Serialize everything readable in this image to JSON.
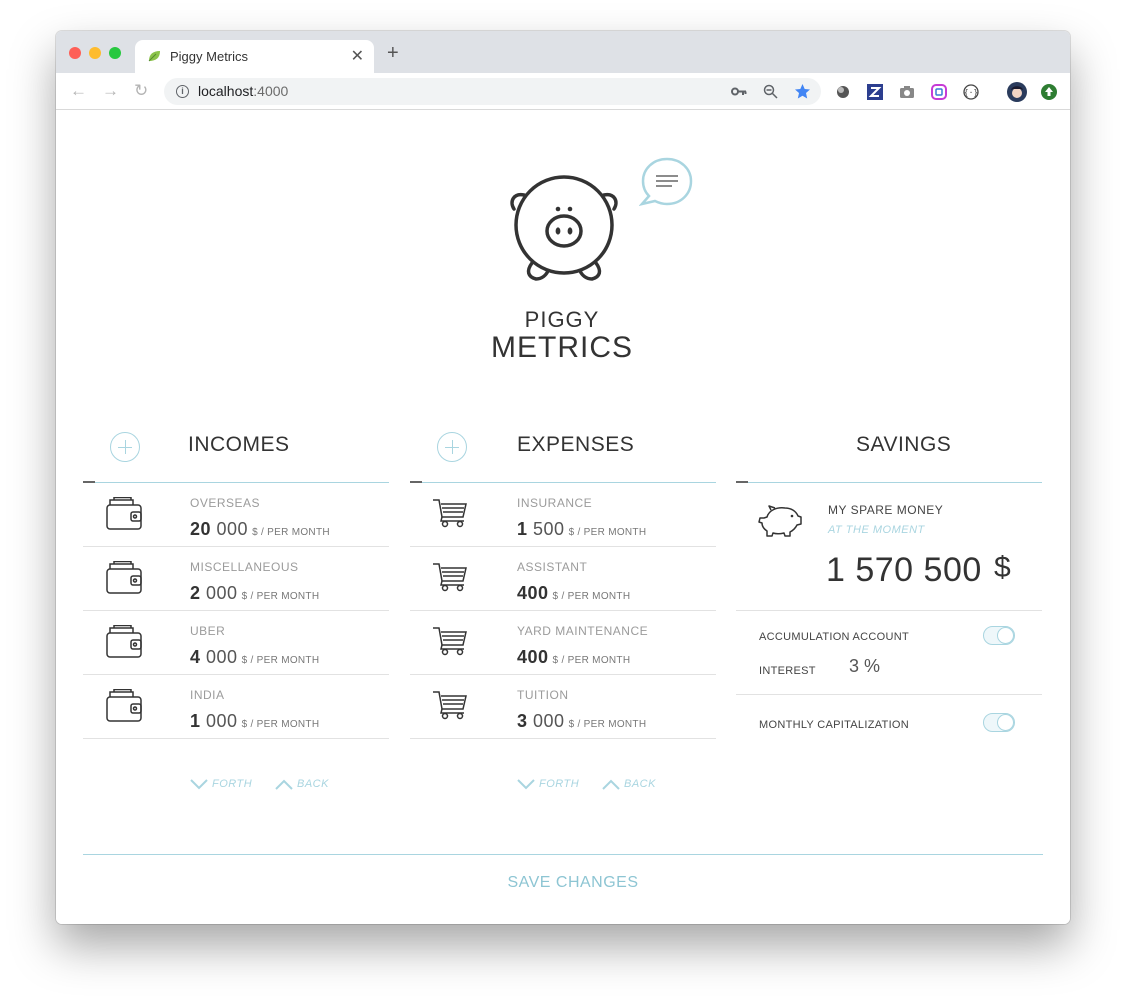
{
  "browser": {
    "tab_title": "Piggy Metrics",
    "url_host": "localhost",
    "url_port": ":4000"
  },
  "brand": {
    "line1": "PIGGY",
    "line2": "METRICS"
  },
  "incomes": {
    "title": "INCOMES",
    "items": [
      {
        "title": "OVERSEAS",
        "amount_bold": "20",
        "amount_rest": " 000",
        "unit": "$ / PER MONTH"
      },
      {
        "title": "MISCELLANEOUS",
        "amount_bold": "2",
        "amount_rest": " 000",
        "unit": "$ / PER MONTH"
      },
      {
        "title": "UBER",
        "amount_bold": "4",
        "amount_rest": " 000",
        "unit": "$ / PER MONTH"
      },
      {
        "title": "INDIA",
        "amount_bold": "1",
        "amount_rest": " 000",
        "unit": "$ / PER MONTH"
      }
    ],
    "forth_label": "FORTH",
    "back_label": "BACK"
  },
  "expenses": {
    "title": "EXPENSES",
    "items": [
      {
        "title": "INSURANCE",
        "amount_bold": "1",
        "amount_rest": " 500",
        "unit": "$ / PER MONTH"
      },
      {
        "title": "ASSISTANT",
        "amount_bold": "400",
        "amount_rest": "",
        "unit": "$ / PER MONTH"
      },
      {
        "title": "YARD MAINTENANCE",
        "amount_bold": "400",
        "amount_rest": "",
        "unit": "$ / PER MONTH"
      },
      {
        "title": "TUITION",
        "amount_bold": "3",
        "amount_rest": " 000",
        "unit": "$ / PER MONTH"
      }
    ],
    "forth_label": "FORTH",
    "back_label": "BACK"
  },
  "savings": {
    "title": "SAVINGS",
    "spare_title": "MY SPARE MONEY",
    "spare_sub": "AT THE MOMENT",
    "spare_amount": "1 570 500",
    "spare_currency": "$",
    "accumulation_label": "ACCUMULATION ACCOUNT",
    "accumulation_on": true,
    "interest_label": "INTEREST",
    "interest_value": "3 %",
    "capitalization_label": "MONTHLY CAPITALIZATION",
    "capitalization_on": true
  },
  "save_label": "SAVE CHANGES",
  "colors": {
    "accent": "#a9d5e0",
    "text": "#333333"
  }
}
